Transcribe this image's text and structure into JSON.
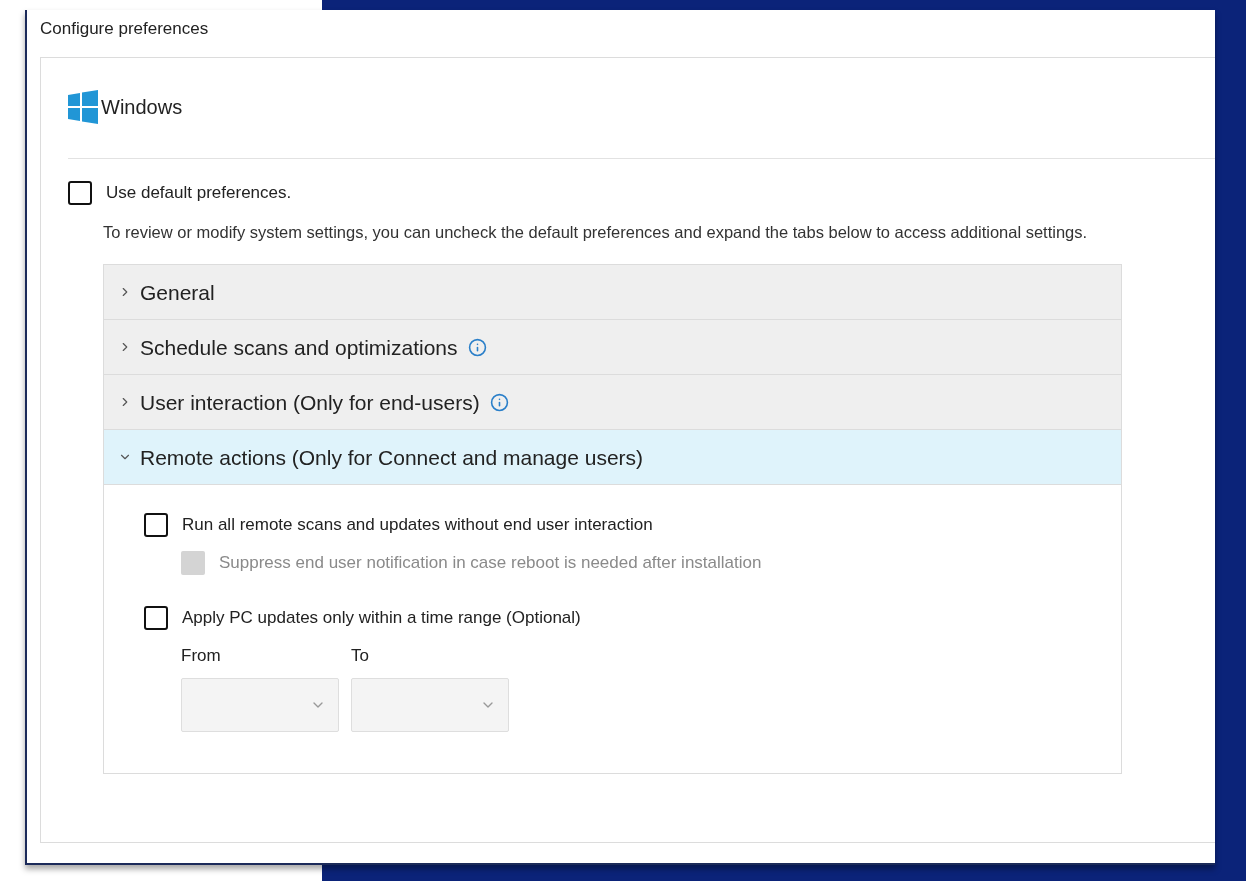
{
  "panel": {
    "title": "Configure preferences"
  },
  "platform": {
    "name": "Windows"
  },
  "default_preferences": {
    "label": "Use default preferences.",
    "checked": false
  },
  "description": "To review or modify system settings, you can uncheck the default preferences and expand the tabs below to access additional settings.",
  "sections": [
    {
      "title": "General",
      "info": false,
      "expanded": false
    },
    {
      "title": "Schedule scans and optimizations",
      "info": true,
      "expanded": false
    },
    {
      "title": "User interaction (Only for end-users)",
      "info": true,
      "expanded": false
    },
    {
      "title": "Remote actions (Only for Connect and manage users)",
      "info": false,
      "expanded": true,
      "options": [
        {
          "label": "Run all remote scans and updates without end user interaction",
          "checked": false,
          "disabled": false,
          "children": [
            {
              "label": "Suppress end user notification in case reboot is needed after installation",
              "checked": false,
              "disabled": true
            }
          ]
        },
        {
          "label": "Apply PC updates only within a time range (Optional)",
          "checked": false,
          "disabled": false
        }
      ],
      "time_range": [
        {
          "label": "From",
          "disabled": true
        },
        {
          "label": "To",
          "disabled": true
        }
      ]
    }
  ]
}
